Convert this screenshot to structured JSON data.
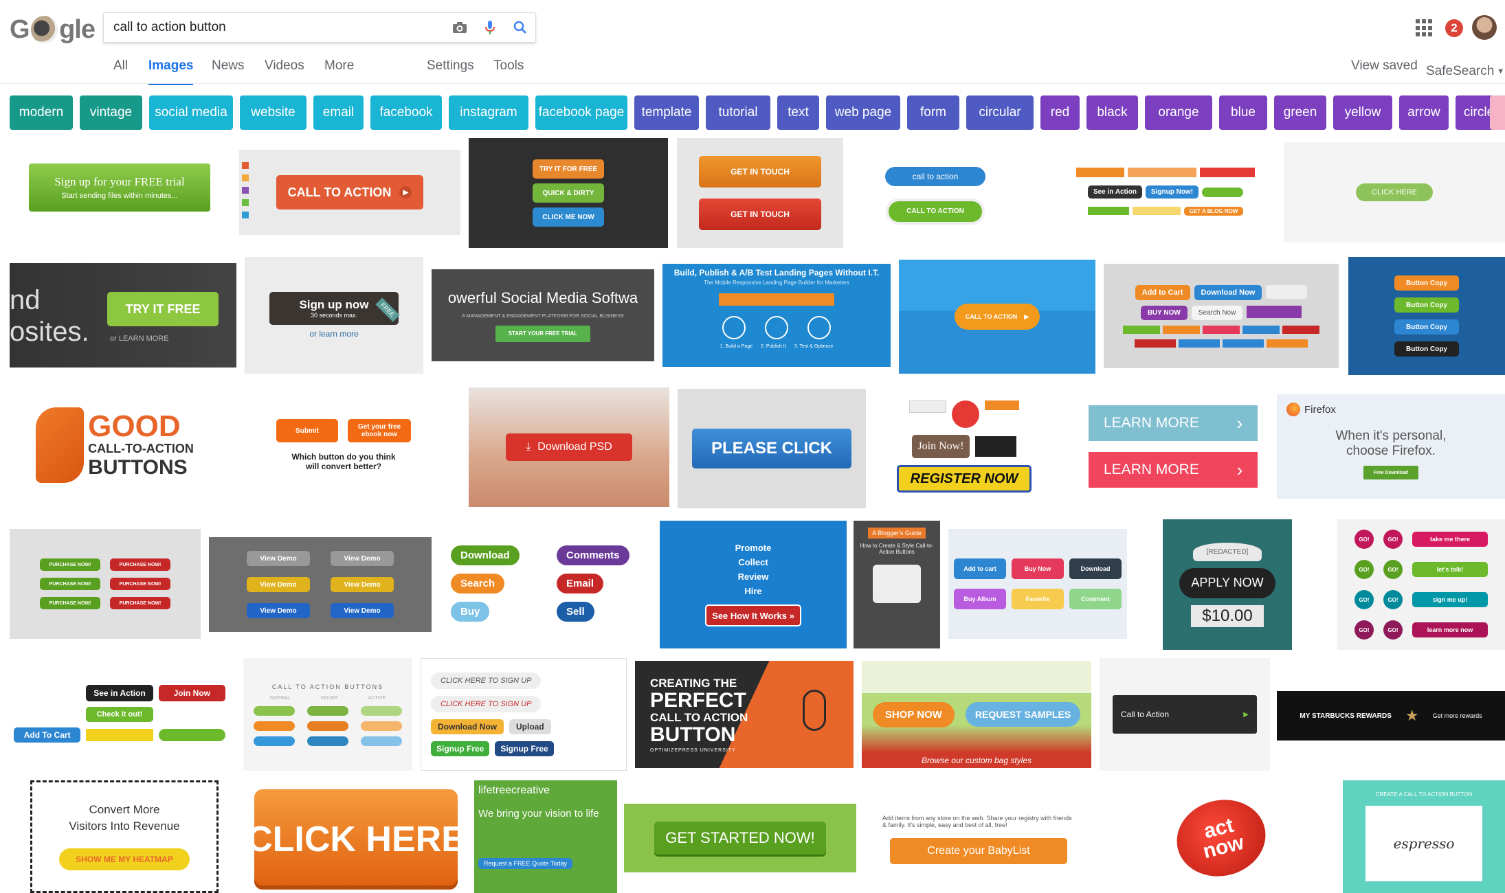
{
  "search": {
    "query": "call to action button"
  },
  "logo": {
    "letters": "gle"
  },
  "nav": {
    "all": "All",
    "images": "Images",
    "news": "News",
    "videos": "Videos",
    "more": "More",
    "settings": "Settings",
    "tools": "Tools",
    "view_saved": "View saved",
    "safesearch": "SafeSearch"
  },
  "notifications": {
    "count": "2"
  },
  "chips": [
    {
      "label": "modern",
      "color": "#189a8b"
    },
    {
      "label": "vintage",
      "color": "#189a8b"
    },
    {
      "label": "social media",
      "color": "#1ab4d4"
    },
    {
      "label": "website",
      "color": "#1ab4d4"
    },
    {
      "label": "email",
      "color": "#1ab4d4"
    },
    {
      "label": "facebook",
      "color": "#1ab4d4"
    },
    {
      "label": "instagram",
      "color": "#1ab4d4"
    },
    {
      "label": "facebook page",
      "color": "#1ab4d4"
    },
    {
      "label": "template",
      "color": "#4f5bc2"
    },
    {
      "label": "tutorial",
      "color": "#4f5bc2"
    },
    {
      "label": "text",
      "color": "#4f5bc2"
    },
    {
      "label": "web page",
      "color": "#4f5bc2"
    },
    {
      "label": "form",
      "color": "#4f5bc2"
    },
    {
      "label": "circular",
      "color": "#4f5bc2"
    },
    {
      "label": "red",
      "color": "#7b3fbf"
    },
    {
      "label": "black",
      "color": "#7b3fbf"
    },
    {
      "label": "orange",
      "color": "#7b3fbf"
    },
    {
      "label": "blue",
      "color": "#7b3fbf"
    },
    {
      "label": "green",
      "color": "#7b3fbf"
    },
    {
      "label": "yellow",
      "color": "#7b3fbf"
    },
    {
      "label": "arrow",
      "color": "#7b3fbf"
    },
    {
      "label": "circle",
      "color": "#7b3fbf"
    }
  ],
  "results": {
    "r1": {
      "a_title": "Sign up for your FREE trial",
      "a_sub": "Start sending files within minutes...",
      "b": "CALL TO ACTION",
      "c1": "TRY IT FOR FREE",
      "c2": "QUICK & DIRTY",
      "c3": "CLICK ME NOW",
      "d1": "GET IN TOUCH",
      "d2": "GET IN TOUCH",
      "e1": "call to action",
      "e2": "CALL TO ACTION",
      "f1": "See in Action",
      "f2": "Signup Now!",
      "f3": "GET A BLOG NOW",
      "g": "CLICK HERE"
    },
    "r2": {
      "a_bg1": "nd",
      "a_bg2": "osites.",
      "a_btn": "TRY IT FREE",
      "a_or": "or  LEARN MORE",
      "b_btn": "Sign up now",
      "b_sub": "30 seconds max.",
      "b_or": "or learn more",
      "b_ribbon": "FREE",
      "c_title": "owerful Social Media Softwa",
      "c_sub": "A MANAGEMENT & ENGAGEMENT PLATFORM FOR SOCIAL BUSINESS",
      "c_btn": "START YOUR FREE TRIAL",
      "d_title": "Build, Publish & A/B Test Landing Pages Without I.T.",
      "d_sub": "The Mobile Responsive Landing Page Builder for Marketers",
      "d_s1": "1. Build a Page",
      "d_s2": "2. Publish It",
      "d_s3": "3. Test & Optimize",
      "e_btn": "CALL TO ACTION",
      "f1": "Add to Cart",
      "f2": "Download Now",
      "f3": "BUY NOW",
      "f4": "Search Now",
      "g": "Button Copy"
    },
    "r3": {
      "a1": "GOOD",
      "a2": "CALL-TO-ACTION",
      "a3": "BUTTONS",
      "b1": "Submit",
      "b2": "Get your free ebook now",
      "b_q": "Which button do you think will convert better?",
      "c": "Download PSD",
      "d": "PLEASE CLICK",
      "e1": "Join Now!",
      "e2": "REGISTER NOW",
      "f1": "LEARN MORE",
      "f2": "LEARN MORE",
      "g_brand": "Firefox",
      "g_text": "When it's personal, choose Firefox.",
      "g_btn": "Free Download"
    },
    "r4": {
      "a": "PURCHASE NOW!",
      "b": "View Demo",
      "c1": "Download",
      "c2": "Comments",
      "c3": "Search",
      "c4": "Email",
      "c5": "Buy",
      "c6": "Sell",
      "d1": "Promote",
      "d2": "Collect",
      "d3": "Review",
      "d4": "Hire",
      "d_btn": "See How It Works »",
      "e_tag": "A Blogger's Guide",
      "e_title": "How to Create & Style Call-to-Action Buttons",
      "f1": "Add to cart",
      "f2": "Buy Now",
      "f3": "Download",
      "f4": "Buy Album",
      "f5": "Favorite",
      "f6": "Comment",
      "g_btn": "APPLY NOW",
      "g_price": "$10.00",
      "g_badge": "[REDACTED]",
      "h1": "GO!",
      "h2": "take me there",
      "h3": "let's talk!",
      "h4": "sign me up!",
      "h5": "learn more now"
    },
    "r5": {
      "a1": "See in Action",
      "a2": "Join Now",
      "a3": "Check it out!",
      "a4": "Add To Cart",
      "b_title": "CALL TO ACTION BUTTONS",
      "b_h1": "NORMAL",
      "b_h2": "HOVER",
      "b_h3": "ACTIVE",
      "c1": "CLICK HERE TO SIGN UP",
      "c2": "Download Now",
      "c3": "Upload",
      "c4": "Signup Free",
      "c5": "Signup Free",
      "d1": "CREATING THE",
      "d2": "PERFECT",
      "d3": "CALL TO ACTION",
      "d4": "BUTTON",
      "d5": "OPTIMIZEPRESS UNIVERSITY",
      "e1": "SHOP NOW",
      "e2": "REQUEST SAMPLES",
      "e3": "Browse our custom bag styles",
      "f": "Call to Action",
      "g1": "Get more rewards",
      "g2": "MY STARBUCKS REWARDS"
    },
    "r6": {
      "a1": "Convert More",
      "a2": "Visitors Into Revenue",
      "a3": "SHOW ME MY HEATMAP",
      "b": "CLICK HERE",
      "c_brand": "lifetreecreative",
      "c_text": "We bring your vision to life",
      "c_btn": "Request a FREE Quote Today",
      "d": "GET STARTED NOW!",
      "e_text": "Add items from any store on the web. Share your registry with friends & family. It's simple, easy and best of all, free!",
      "e_btn": "Create your BabyList",
      "f1": "act",
      "f2": "now",
      "g_title": "CREATE A CALL TO ACTION BUTTON",
      "g_brand": "espresso"
    }
  }
}
